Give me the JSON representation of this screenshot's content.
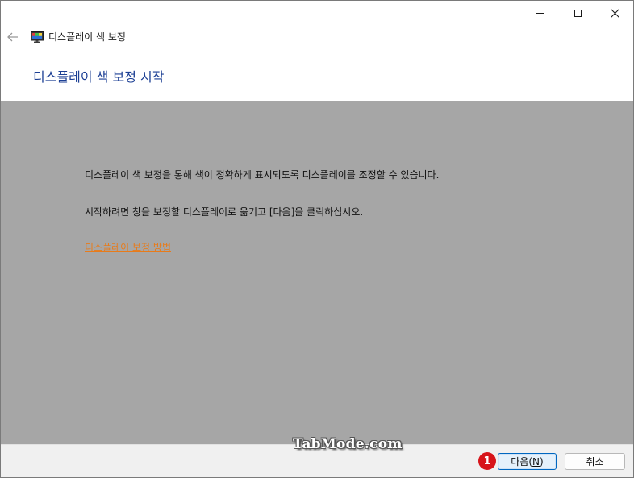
{
  "window": {
    "title": "디스플레이 색 보정",
    "controls": {
      "minimize": "minimize-icon",
      "maximize": "maximize-icon",
      "close": "close-icon"
    }
  },
  "nav": {
    "back_icon": "back-arrow-icon",
    "app_icon": "display-monitor-icon"
  },
  "page": {
    "heading": "디스플레이 색 보정 시작",
    "paragraph1": "디스플레이 색 보정을 통해 색이 정확하게 표시되도록 디스플레이를 조정할 수 있습니다.",
    "paragraph2": "시작하려면 창을 보정할 디스플레이로 옮기고 [다음]을 클릭하십시오.",
    "help_link": "디스플레이 보정 방법"
  },
  "footer": {
    "watermark": "TabMode.com",
    "badge_number": "1",
    "next_label_prefix": "다음(",
    "next_label_key": "N",
    "next_label_suffix": ")",
    "cancel_label": "취소"
  },
  "colors": {
    "heading": "#1c3f94",
    "link": "#e87b1a",
    "content_bg": "#a6a6a6",
    "badge": "#d7141a",
    "primary_button_border": "#0067c0"
  }
}
